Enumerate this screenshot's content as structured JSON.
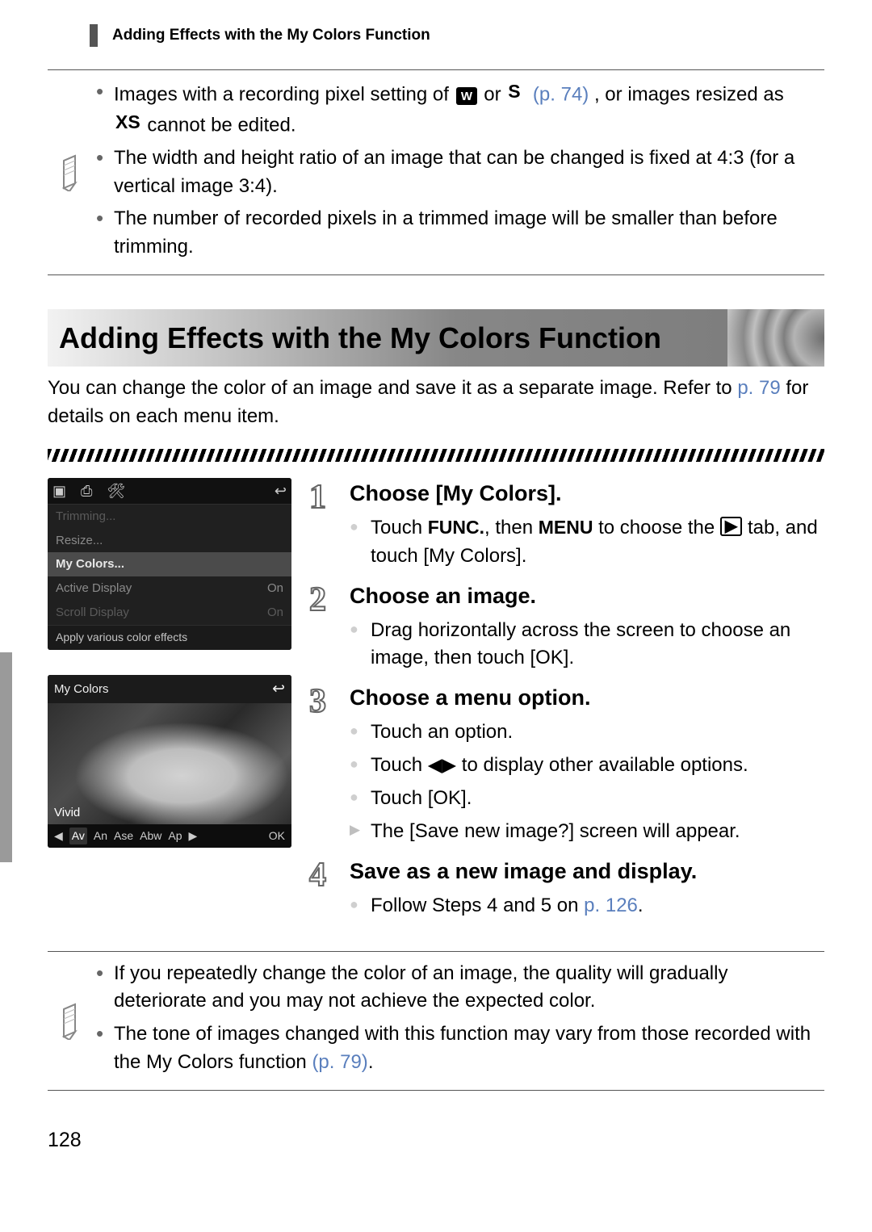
{
  "running_head": "Adding Effects with the My Colors Function",
  "page_number": "128",
  "top_note": {
    "items": [
      {
        "pre": "Images with a recording pixel setting of ",
        "w_icon": "W",
        "or_text": " or ",
        "s_icon": "S",
        "page_ref": "(p. 74)",
        "post1": ", or images resized as ",
        "xs_icon": "XS",
        "post2": " cannot be edited."
      },
      {
        "text": "The width and height ratio of an image that can be changed is fixed at 4:3 (for a vertical image 3:4)."
      },
      {
        "text": "The number of recorded pixels in a trimmed image will be smaller than before trimming."
      }
    ]
  },
  "section_title": "Adding Effects with the My Colors Function",
  "section_intro": {
    "pre": "You can change the color of an image and save it as a separate image. Refer to ",
    "page_ref": "p. 79",
    "post": " for details on each menu item."
  },
  "lcd1": {
    "row0": "Trimming...",
    "row1": "Resize...",
    "row_sel": "My Colors...",
    "row2_l": "Active Display",
    "row2_r": "On",
    "row3_l": "Scroll Display",
    "row3_r": "On",
    "hint": "Apply various color effects"
  },
  "lcd2": {
    "title": "My Colors",
    "label": "Vivid",
    "opts": [
      "Av",
      "An",
      "Ase",
      "Abw",
      "Ap"
    ],
    "opts_sel_index": 0,
    "left_arrow": "◀",
    "right_arrow": "▶",
    "ok": "OK",
    "back": "↩"
  },
  "steps": {
    "s1": {
      "num": "1",
      "head": "Choose [My Colors].",
      "line1_pre": "Touch ",
      "func": "FUNC.",
      "then": ", then ",
      "menu": "MENU",
      "line1_mid": " to choose the ",
      "play_icon": "▶",
      "line1_post": " tab, and touch [My Colors]."
    },
    "s2": {
      "num": "2",
      "head": "Choose an image.",
      "line": "Drag horizontally across the screen to choose an image, then touch [OK]."
    },
    "s3": {
      "num": "3",
      "head": "Choose a menu option.",
      "b1": "Touch an option.",
      "b2_pre": "Touch ",
      "arrows": "◀▶",
      "b2_post": " to display other available options.",
      "b3": "Touch [OK].",
      "b4": "The [Save new image?] screen will appear."
    },
    "s4": {
      "num": "4",
      "head": "Save as a new image and display.",
      "line_pre": "Follow Steps 4 and 5 on ",
      "page_ref": "p. 126",
      "line_post": "."
    }
  },
  "bottom_note": {
    "b1": "If you repeatedly change the color of an image, the quality will gradually deteriorate and you may not achieve the expected color.",
    "b2_pre": "The tone of images changed with this function may vary from those recorded with the My Colors function ",
    "b2_ref": "(p. 79)",
    "b2_post": "."
  }
}
